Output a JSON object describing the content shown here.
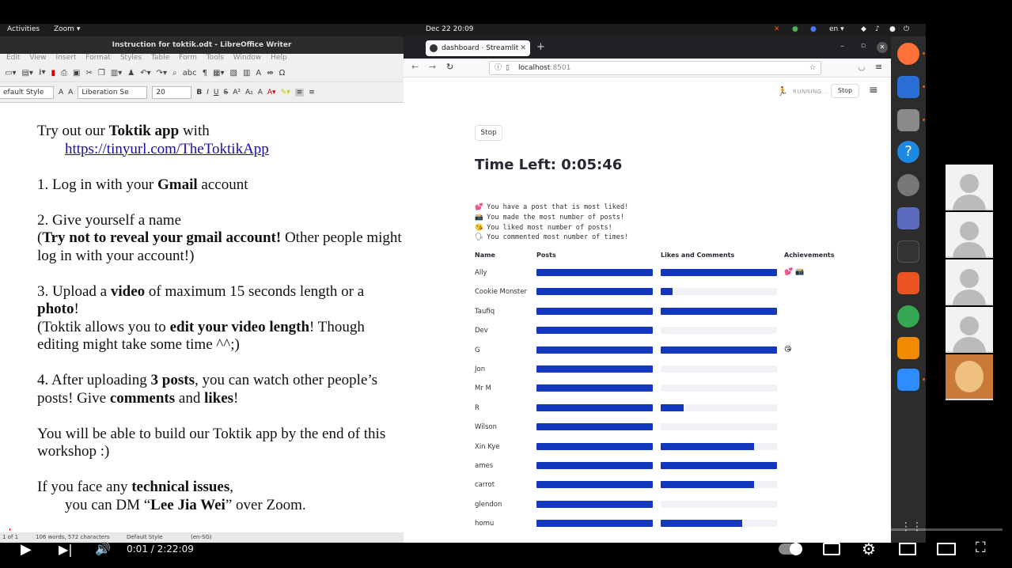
{
  "topbar": {
    "activities": "Activities",
    "app": "Zoom",
    "clock": "Dec 22  20:09",
    "lang": "en"
  },
  "writer": {
    "title": "Instruction for toktik.odt - LibreOffice Writer",
    "menu": [
      "Edit",
      "View",
      "Insert",
      "Format",
      "Styles",
      "Table",
      "Form",
      "Tools",
      "Window",
      "Help"
    ],
    "para_style": "efault Style",
    "font_name": "Liberation Se",
    "font_size": "20",
    "content": {
      "p1_a": "Try out our ",
      "p1_b": "Toktik app",
      "p1_c": " with",
      "link": "https://tinyurl.com/TheToktikApp",
      "p2_a": "1. Log in with your ",
      "p2_b": "Gmail",
      "p2_c": " account",
      "p3_a": "2. Give yourself a name",
      "p3_b": "(",
      "p3_c": "Try not to reveal your gmail account!",
      "p3_d": " Other people might log in with your account!)",
      "p4_a": "3. Upload a ",
      "p4_b": "video",
      "p4_c": " of maximum 15 seconds length or a ",
      "p4_d": "photo",
      "p4_e": "!",
      "p4_f": "(Toktik allows you to ",
      "p4_g": "edit your video length",
      "p4_h": "! Though editing might take some time ^^;)",
      "p5_a": "4. After uploading ",
      "p5_b": "3 posts",
      "p5_c": ", you can watch other people’s posts! Give ",
      "p5_d": "comments",
      "p5_e": " and ",
      "p5_f": "likes",
      "p5_g": "!",
      "p6": "You will be able to build our Toktik app by the end of this workshop :)",
      "p7_a": "If you face any ",
      "p7_b": "technical issues",
      "p7_c": ",",
      "p7_d": "you can DM “",
      "p7_e": "Lee Jia Wei",
      "p7_f": "” over Zoom."
    },
    "status": {
      "page": "1 of 1",
      "words": "106 words, 572 characters",
      "style": "Default Style",
      "lang": "(en-SG)"
    }
  },
  "browser": {
    "tab_title": "dashboard · Streamlit",
    "url_host": "localhost",
    "url_port": ":8501",
    "running": "RUNNING...",
    "stop_top": "Stop"
  },
  "dashboard": {
    "stop_button": "Stop",
    "time_left": "Time Left: 0:05:46",
    "legend": [
      {
        "icon": "💕",
        "text": "You have a post that is most liked!"
      },
      {
        "icon": "📸",
        "text": "You made the most number of posts!"
      },
      {
        "icon": "😘",
        "text": "You liked most number of posts!"
      },
      {
        "icon": "🗣",
        "text": "You commented most number of times!"
      }
    ],
    "columns": [
      "Name",
      "Posts",
      "Likes and Comments",
      "Achievements"
    ],
    "rows": [
      {
        "name": "Ally",
        "posts": 1.0,
        "likes": 1.0,
        "ach": "💕 📸"
      },
      {
        "name": "Cookie Monster",
        "posts": 1.0,
        "likes": 0.1,
        "ach": ""
      },
      {
        "name": "Taufiq",
        "posts": 1.0,
        "likes": 1.0,
        "ach": ""
      },
      {
        "name": "Dev",
        "posts": 1.0,
        "likes": 0.0,
        "ach": ""
      },
      {
        "name": "G",
        "posts": 1.0,
        "likes": 1.0,
        "ach": "😘"
      },
      {
        "name": "Jon",
        "posts": 1.0,
        "likes": 0.0,
        "ach": ""
      },
      {
        "name": "Mr M",
        "posts": 1.0,
        "likes": 0.0,
        "ach": ""
      },
      {
        "name": "R",
        "posts": 1.0,
        "likes": 0.2,
        "ach": ""
      },
      {
        "name": "Wilson",
        "posts": 1.0,
        "likes": 0.0,
        "ach": ""
      },
      {
        "name": "Xin Kye",
        "posts": 1.0,
        "likes": 0.8,
        "ach": ""
      },
      {
        "name": "ames",
        "posts": 1.0,
        "likes": 1.0,
        "ach": ""
      },
      {
        "name": "carrot",
        "posts": 1.0,
        "likes": 0.8,
        "ach": ""
      },
      {
        "name": "glendon",
        "posts": 1.0,
        "likes": 0.0,
        "ach": ""
      },
      {
        "name": "homu",
        "posts": 1.0,
        "likes": 0.7,
        "ach": ""
      }
    ]
  },
  "video": {
    "time": "0:01 / 2:22:09",
    "progress": 0.0008
  }
}
